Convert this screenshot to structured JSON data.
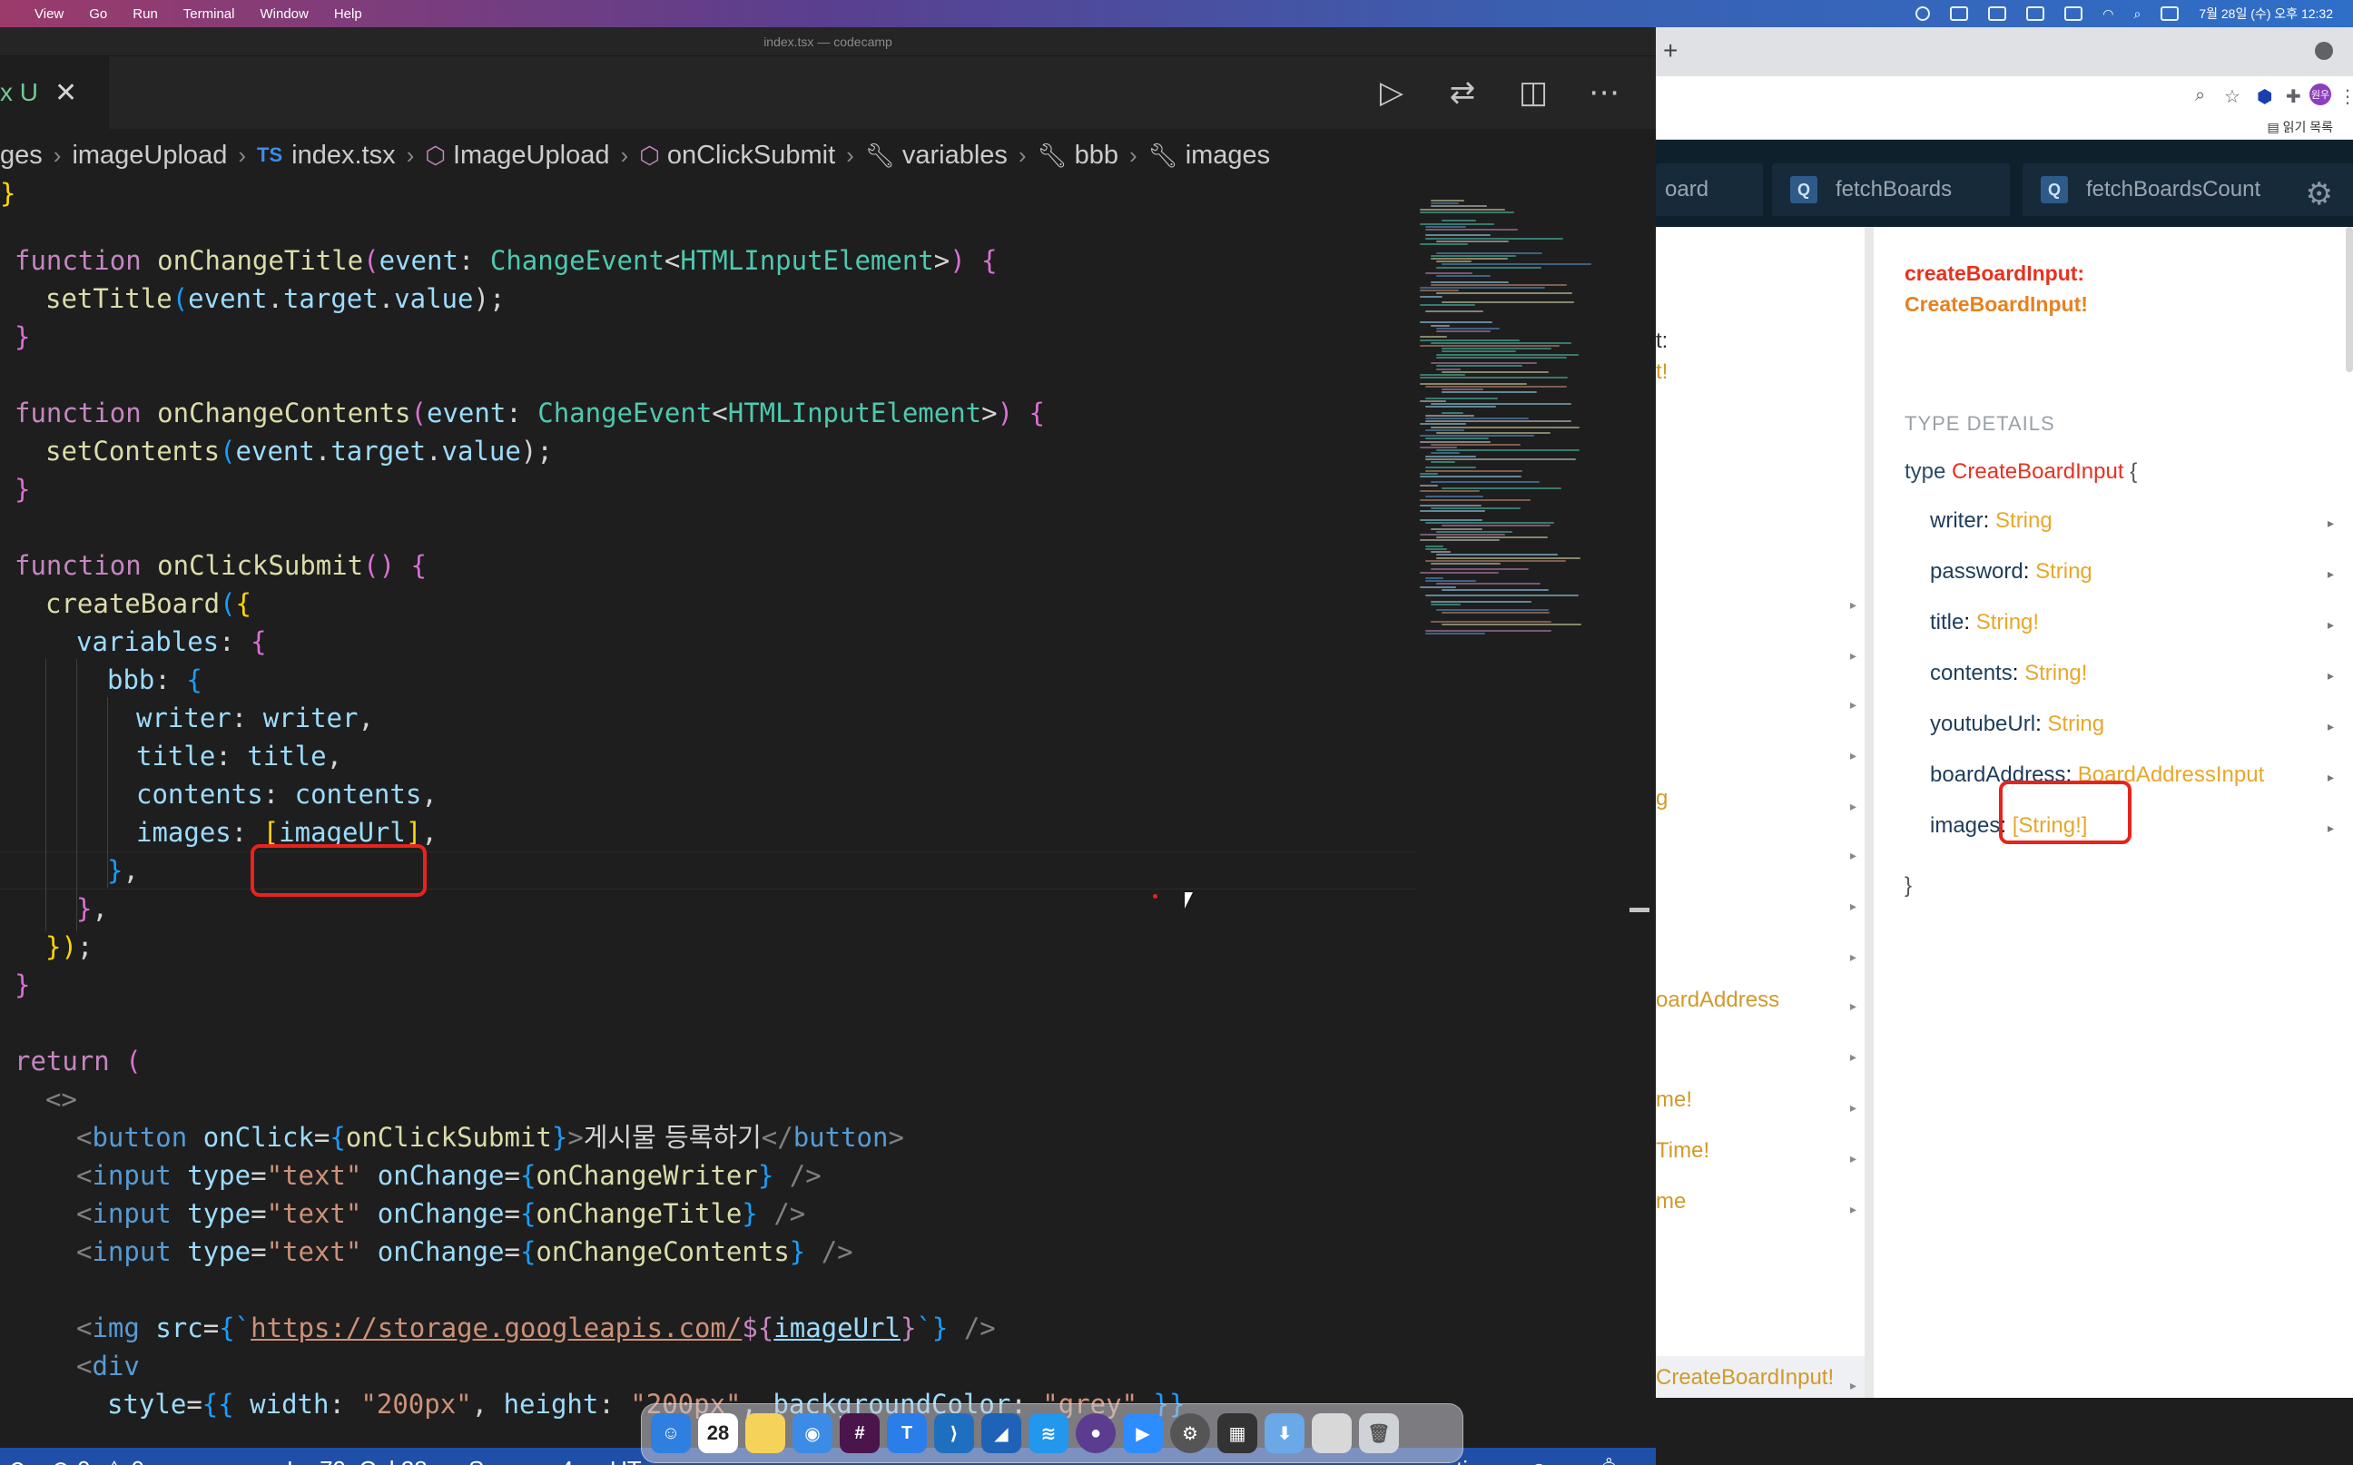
{
  "menubar": {
    "items": [
      "View",
      "Go",
      "Run",
      "Terminal",
      "Window",
      "Help"
    ],
    "datetime": "7월 28일 (수) 오후 12:32"
  },
  "editor": {
    "window_title": "index.tsx — codecamp",
    "active_tab": "x U",
    "breadcrumb": [
      "ges",
      "imageUpload",
      "index.tsx",
      "ImageUpload",
      "onClickSubmit",
      "variables",
      "bbb",
      "images"
    ],
    "breadcrumb_ts_badge": "TS"
  },
  "statusbar": {
    "errors": "0",
    "warnings": "0",
    "position": "Ln 79, Col 28",
    "spaces": "Spaces: 4",
    "encoding_partial": "UT",
    "formatter_partial": "tier"
  },
  "dock": {
    "calendar_day": "28"
  },
  "browser": {
    "reading_list": "읽기 목록",
    "profile_initial": "원우",
    "tabs": [
      {
        "label": "oard"
      },
      {
        "label": "fetchBoards",
        "badge": "Q"
      },
      {
        "label": "fetchBoardsCount",
        "badge": "Q"
      }
    ],
    "left_fragments": [
      "t:",
      "t!",
      "g",
      "oardAddress",
      "me!",
      "Time!",
      "me",
      "CreateBoardInput!"
    ],
    "docs": {
      "arg_name": "createBoardInput:",
      "arg_type": "CreateBoardInput!",
      "section_title": "TYPE DETAILS",
      "type_keyword": "type",
      "type_name": "CreateBoardInput",
      "open_brace": "{",
      "close_brace": "}",
      "fields": [
        {
          "name": "writer",
          "type": "String"
        },
        {
          "name": "password",
          "type": "String"
        },
        {
          "name": "title",
          "type": "String!"
        },
        {
          "name": "contents",
          "type": "String!"
        },
        {
          "name": "youtubeUrl",
          "type": "String"
        },
        {
          "name": "boardAddress",
          "type": "BoardAddressInput"
        },
        {
          "name": "images",
          "type": "[String!]"
        }
      ]
    }
  },
  "code": {
    "l_brace_close_1": "}",
    "onChangeTitle": [
      "function",
      "onChangeTitle",
      "(",
      "event",
      ":",
      "ChangeEvent",
      "<",
      "HTMLInputElement",
      ">",
      ")",
      "{"
    ],
    "setTitle": [
      "setTitle",
      "(",
      "event",
      ".",
      "target",
      ".",
      "value",
      ");"
    ],
    "onChangeContents": [
      "function",
      "onChangeContents",
      "(",
      "event",
      ":",
      "ChangeEvent",
      "<",
      "HTMLInputElement",
      ">",
      ")",
      "{"
    ],
    "setContents": [
      "setContents",
      "(",
      "event",
      ".",
      "target",
      ".",
      "value",
      ");"
    ],
    "onClickSubmit": [
      "function",
      "onClickSubmit",
      "()",
      "{"
    ],
    "createBoard": [
      "createBoard",
      "(",
      "{"
    ],
    "variables": [
      "variables",
      ":",
      "{"
    ],
    "bbb": [
      "bbb",
      ":",
      "{"
    ],
    "writer": [
      "writer",
      ":",
      "writer",
      ","
    ],
    "title": [
      "title",
      ":",
      "title",
      ","
    ],
    "contents": [
      "contents",
      ":",
      "contents",
      ","
    ],
    "images": [
      "images",
      ":",
      "[",
      "imageUrl",
      "]",
      ","
    ],
    "close3": [
      "}",
      ","
    ],
    "close2": [
      "}",
      ","
    ],
    "close1": [
      "})",
      ";"
    ],
    "close0": "}",
    "return": [
      "return",
      "("
    ],
    "frag_open": "<>",
    "button": [
      "<",
      "button",
      "onClick",
      "=",
      "{",
      "onClickSubmit",
      "}",
      ">",
      "게시물 등록하기",
      "</",
      "button",
      ">"
    ],
    "input1": [
      "<",
      "input",
      "type",
      "=",
      "\"text\"",
      "onChange",
      "=",
      "{",
      "onChangeWriter",
      "}",
      "/>"
    ],
    "input2": [
      "<",
      "input",
      "type",
      "=",
      "\"text\"",
      "onChange",
      "=",
      "{",
      "onChangeTitle",
      "}",
      "/>"
    ],
    "input3": [
      "<",
      "input",
      "type",
      "=",
      "\"text\"",
      "onChange",
      "=",
      "{",
      "onChangeContents",
      "}",
      "/>"
    ],
    "img": [
      "<",
      "img",
      "src",
      "=",
      "{`",
      "https://storage.googleapis.com/",
      "${",
      "imageUrl",
      "}",
      "`}",
      "/>"
    ],
    "div": [
      "<",
      "div"
    ],
    "style": [
      "style",
      "=",
      "{{",
      "width",
      ":",
      "\"200px\"",
      ",",
      "height",
      ":",
      "\"200px\"",
      ",",
      "backgroundColor",
      ":",
      "\"grey\"",
      "}}"
    ]
  },
  "colors": {
    "accent_red": "#e8231d",
    "status_bar": "#1f4fa8",
    "graphql_field_type": "#e8a72a"
  }
}
